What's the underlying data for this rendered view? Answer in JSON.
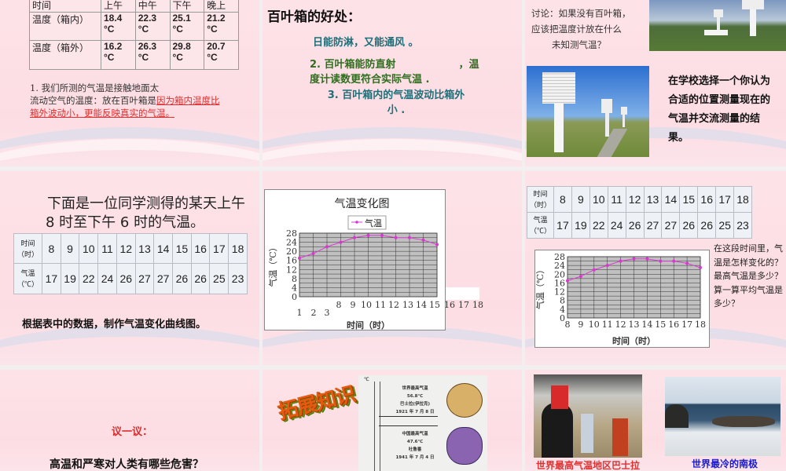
{
  "slide1": {
    "table": {
      "header": [
        "时间",
        "上午",
        "中午",
        "下午",
        "晚上"
      ],
      "rows": [
        {
          "label": "温度（箱内）",
          "values": [
            "18.4 °C",
            "22.3 °C",
            "25.1 °C",
            "21.2 °C"
          ]
        },
        {
          "label": "温度（箱外）",
          "values": [
            "16.2 °C",
            "26.3 °C",
            "29.8 °C",
            "20.7 °C"
          ]
        }
      ]
    },
    "text_line1": "1. 我们所测的气温是接触地面太",
    "text_line2": "流动空气的温度：放在百叶箱是",
    "text_red": "因为箱内温度比箱外波动小，更能反映真实的气温。"
  },
  "slide2": {
    "title": "百叶箱的好处：",
    "point1": "日能防淋，又能通风 。",
    "point2a": "2.  百叶箱能防直射",
    "point2b": "，温",
    "point2c": "度计读数更符合实际气温 .",
    "point3": "3. 百叶箱内的气温波动比箱外",
    "point3b": "小 ."
  },
  "slide3": {
    "question1": "讨论：如果没有百叶箱，",
    "question2": "应该把温度计放在什么",
    "question3": "未知测气温？",
    "task": "在学校选择一个你认为合适的位置测量现在的气温并交流测量的结果。"
  },
  "slide4": {
    "intro": "下面是一位同学测得的某天上午 8 时至下午 6 时的气温。",
    "row_labels": [
      "时间（时）",
      "气温（℃）"
    ],
    "hours": [
      "8",
      "9",
      "10",
      "11",
      "12",
      "13",
      "14",
      "15",
      "16",
      "17",
      "18"
    ],
    "temps": [
      "17",
      "19",
      "22",
      "24",
      "26",
      "27",
      "27",
      "26",
      "26",
      "25",
      "23"
    ],
    "instruction": "根据表中的数据，制作气温变化曲线图。"
  },
  "slide6": {
    "question": "在这段时间里，气温是怎样变化的？最高气温是多少？算一算平均气温是多少？"
  },
  "slide7": {
    "title": "议一议：",
    "question": "高温和严寒对人类有哪些危害？"
  },
  "slide8": {
    "title": "拓展知识",
    "thermo": {
      "unit": "℃",
      "l1": "世界最高气温",
      "l2": "56.8℃",
      "l3": "巴士拉(伊拉克)",
      "l4": "1921 年 7 月 8 日",
      "l5": "中国最高气温",
      "l6": "47.6℃",
      "l7": "吐鲁番",
      "l8": "1941 年 7 月 4 日"
    }
  },
  "slide9": {
    "caption_hot": "世界最高气温地区巴士拉",
    "caption_cold": "世界最冷的南极"
  },
  "colors": {
    "series": "#d838d0",
    "plot_bg": "#c0c0c0",
    "red": "#e03030",
    "blue": "#1a1ad0",
    "green": "#2f6e1e"
  },
  "chart_data": [
    {
      "type": "line",
      "title": "气温变化图",
      "legend": [
        "气温"
      ],
      "xlabel": "时间（时）",
      "ylabel": "气温（℃）",
      "x_tick_labels": [
        "1",
        "2",
        "3",
        "8",
        "9",
        "10",
        "11",
        "12",
        "13",
        "14",
        "15",
        "16",
        "17",
        "18"
      ],
      "x": [
        8,
        9,
        10,
        11,
        12,
        13,
        14,
        15,
        16,
        17,
        18
      ],
      "series": [
        {
          "name": "气温",
          "values": [
            17,
            19,
            22,
            24,
            26,
            27,
            27,
            26,
            26,
            25,
            23
          ]
        }
      ],
      "yticks": [
        0,
        4,
        8,
        12,
        16,
        20,
        24,
        28
      ],
      "ylim": [
        0,
        28
      ],
      "grid": true
    },
    {
      "type": "line",
      "title": "",
      "xlabel": "时间（时）",
      "ylabel": "气温（℃）",
      "x_tick_labels": [
        "8",
        "9",
        "10",
        "11",
        "12",
        "13",
        "14",
        "15",
        "16",
        "17",
        "18"
      ],
      "x": [
        8,
        9,
        10,
        11,
        12,
        13,
        14,
        15,
        16,
        17,
        18
      ],
      "series": [
        {
          "name": "气温",
          "values": [
            17,
            19,
            22,
            24,
            26,
            27,
            27,
            26,
            26,
            25,
            23
          ]
        }
      ],
      "yticks": [
        0,
        4,
        8,
        12,
        16,
        20,
        24,
        28
      ],
      "ylim": [
        0,
        28
      ],
      "grid": true
    }
  ]
}
